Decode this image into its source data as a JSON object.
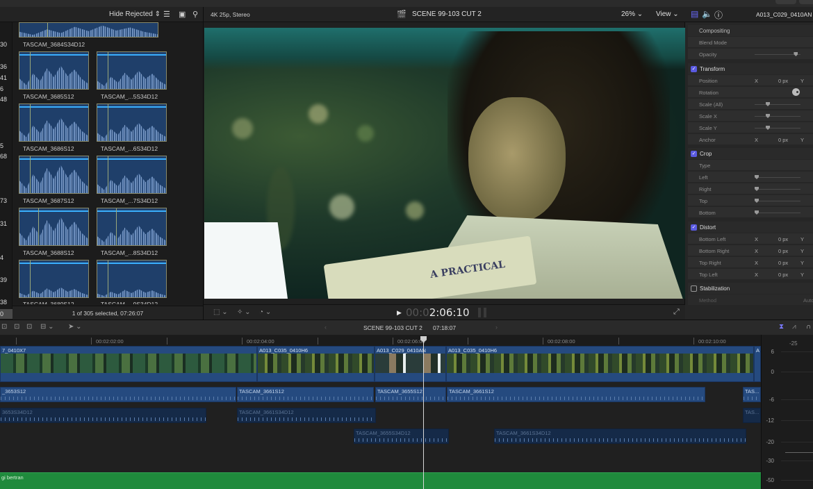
{
  "browser": {
    "filter_label": "Hide Rejected",
    "row_numbers": [
      "30",
      "36",
      "41",
      "6",
      "48",
      "5",
      "68",
      "73",
      "31",
      "4",
      "39",
      "38",
      "0"
    ],
    "clips": [
      {
        "name": "TASCAM_3684S34D12"
      },
      {
        "name": "TASCAM_3685S12"
      },
      {
        "name": "TASCAM_...5S34D12"
      },
      {
        "name": "TASCAM_3686S12"
      },
      {
        "name": "TASCAM_...6S34D12"
      },
      {
        "name": "TASCAM_3687S12"
      },
      {
        "name": "TASCAM_...7S34D12"
      },
      {
        "name": "TASCAM_3688S12"
      },
      {
        "name": "TASCAM_...8S34D12"
      },
      {
        "name": "TASCAM_3689S12"
      },
      {
        "name": "TASCAM_...9S34D12"
      }
    ],
    "status": "1 of 305 selected, 07:26:07"
  },
  "viewer": {
    "format": "4K 25p, Stereo",
    "project_title": "SCENE 99-103 CUT 2",
    "zoom": "26%",
    "view_menu": "View",
    "book_text": "A PRACTICAL",
    "timecode_dim": "00:0",
    "timecode": "2:06:10"
  },
  "inspector": {
    "clip_name": "A013_C029_0410AN",
    "sections": {
      "compositing": {
        "title": "Compositing",
        "blend_mode_label": "Blend Mode",
        "opacity_label": "Opacity",
        "opacity_value": 0.9
      },
      "transform": {
        "title": "Transform",
        "enabled": true,
        "position_label": "Position",
        "rotation_label": "Rotation",
        "scale_all_label": "Scale (All)",
        "scale_x_label": "Scale X",
        "scale_y_label": "Scale Y",
        "anchor_label": "Anchor"
      },
      "crop": {
        "title": "Crop",
        "enabled": true,
        "type_label": "Type",
        "left_label": "Left",
        "right_label": "Right",
        "top_label": "Top",
        "bottom_label": "Bottom"
      },
      "distort": {
        "title": "Distort",
        "enabled": true,
        "bottom_left_label": "Bottom Left",
        "bottom_right_label": "Bottom Right",
        "top_right_label": "Top Right",
        "top_left_label": "Top Left"
      },
      "stabilization": {
        "title": "Stabilization",
        "enabled": false,
        "method_label": "Method",
        "method_value": "Auto"
      }
    },
    "x_label": "X",
    "y_label": "Y",
    "zero_px": "0 px"
  },
  "timeline": {
    "project_title": "SCENE 99-103 CUT 2",
    "duration": "07:18:07",
    "ruler": [
      "00:02:02:00",
      "00:02:04:00",
      "00:02:06:00",
      "00:02:08:00",
      "00:02:10:00"
    ],
    "video_clips": [
      {
        "name": "7_0410X7"
      },
      {
        "name": "A013_C035_0410H6"
      },
      {
        "name": "A013_C029_0410AN"
      },
      {
        "name": "A013_C035_0410H6"
      },
      {
        "name": "A"
      }
    ],
    "audio_row1": [
      {
        "name": "_3653S12"
      },
      {
        "name": "TASCAM_3661S12"
      },
      {
        "name": "TASCAM_3655S12"
      },
      {
        "name": "TASCAM_3661S12"
      },
      {
        "name": "TAS..."
      }
    ],
    "audio_row2": [
      {
        "name": "3653S34D12"
      },
      {
        "name": "TASCAM_3661S34D12"
      },
      {
        "name": "TAS..."
      }
    ],
    "audio_row3": [
      {
        "name": "TASCAM_3655S34D12"
      },
      {
        "name": "TASCAM_3661S34D12"
      }
    ],
    "music_clip": "gi bertran"
  },
  "audio_meter": {
    "top_label": "-25",
    "labels": [
      "6",
      "0",
      "-6",
      "-12",
      "-20",
      "-30",
      "-50"
    ]
  }
}
